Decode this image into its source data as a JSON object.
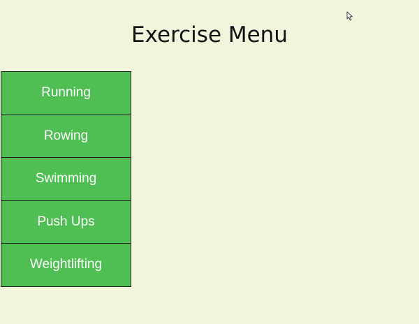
{
  "header": {
    "title": "Exercise Menu"
  },
  "menu": {
    "items": [
      {
        "label": "Running"
      },
      {
        "label": "Rowing"
      },
      {
        "label": "Swimming"
      },
      {
        "label": "Push Ups"
      },
      {
        "label": "Weightlifting"
      }
    ]
  },
  "colors": {
    "background": "#f2f4dc",
    "button_fill": "#4fbe53",
    "button_text": "#ffffff"
  },
  "icons": {
    "cursor": "mouse-pointer-icon"
  }
}
